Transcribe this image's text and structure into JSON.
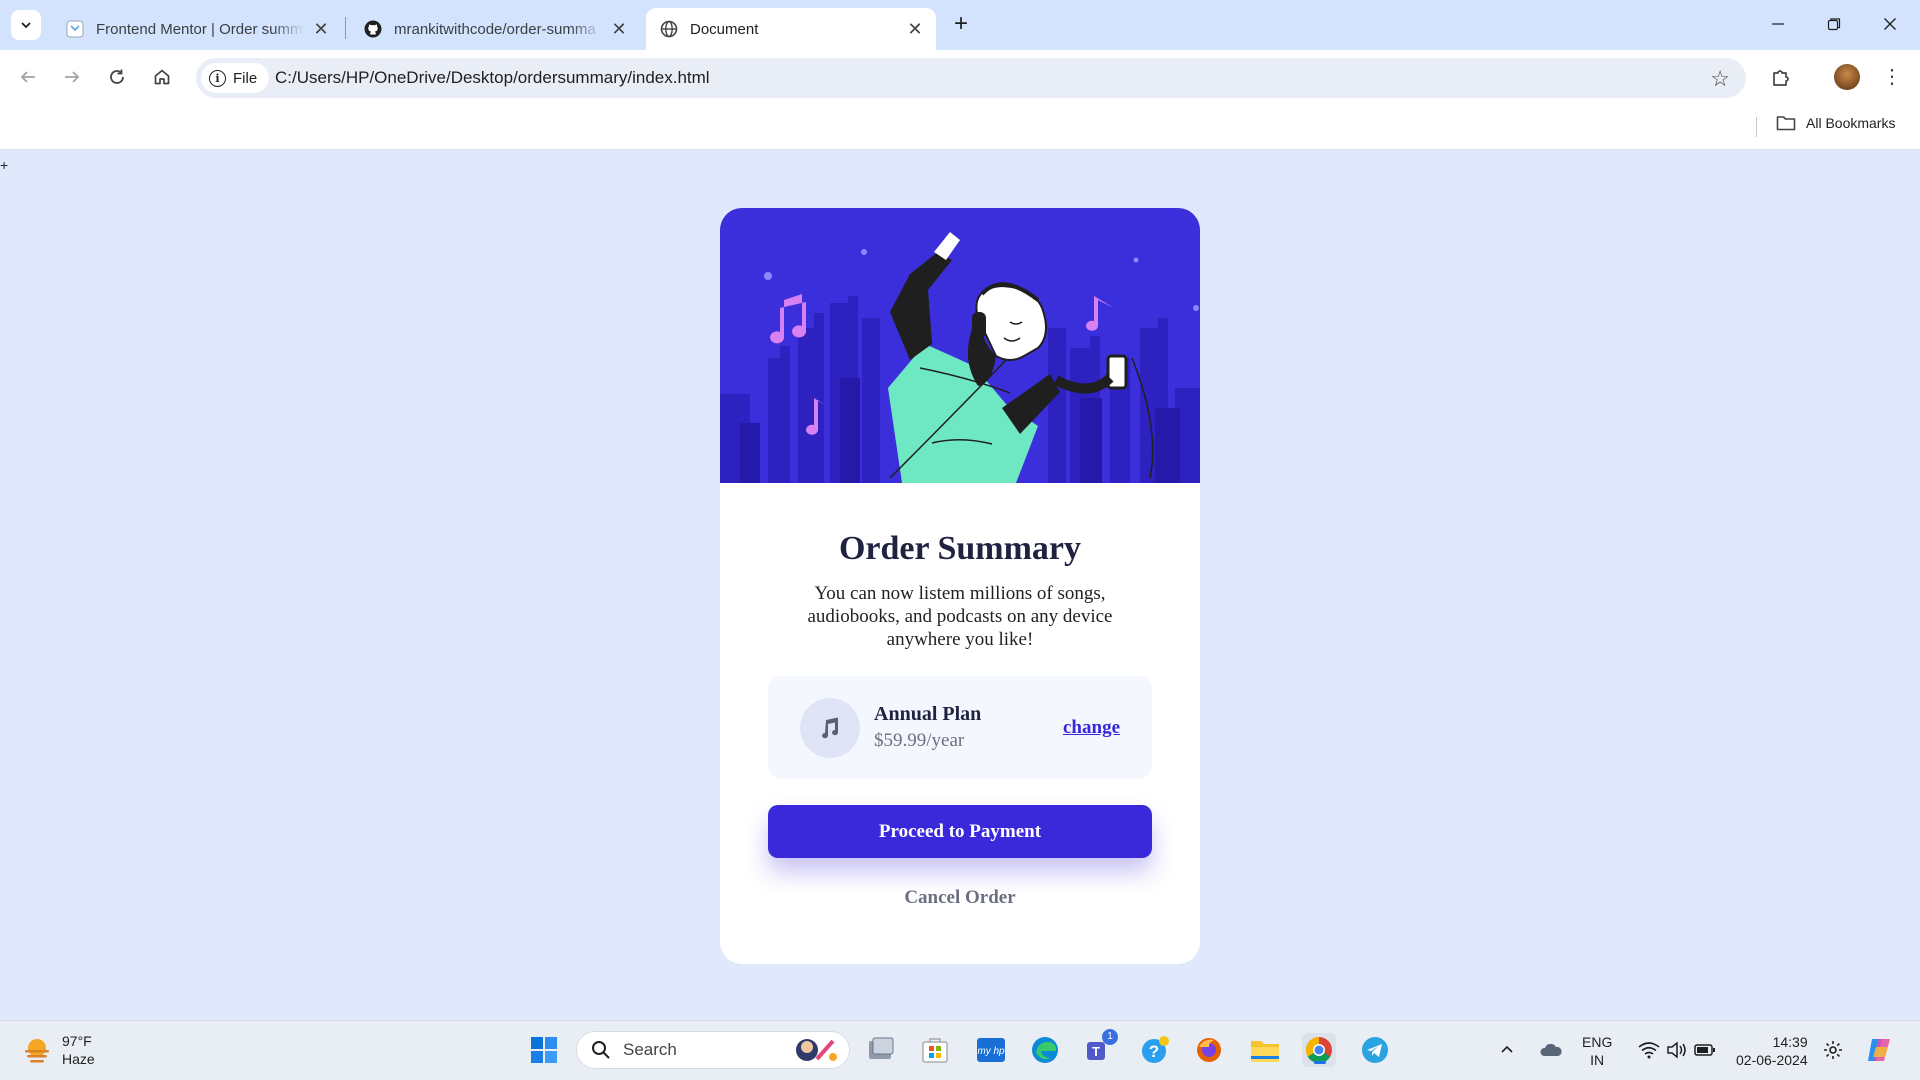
{
  "browser": {
    "tabs": [
      {
        "title": "Frontend Mentor | Order summ",
        "icon": "frontend-mentor-icon",
        "active": false
      },
      {
        "title": "mrankitwithcode/order-summa",
        "icon": "github-icon",
        "active": false
      },
      {
        "title": "Document",
        "icon": "globe-icon",
        "active": true
      }
    ],
    "close_glyph": "✕",
    "new_tab_glyph": "+",
    "chip_label": "File",
    "url": "C:/Users/HP/OneDrive/Desktop/ordersummary/index.html",
    "bookmarks_label": "All Bookmarks"
  },
  "card": {
    "title": "Order Summary",
    "description": "You can now listem millions of songs, audiobooks, and podcasts on any device anywhere you like!",
    "plan_name": "Annual Plan",
    "plan_price": "$59.99/year",
    "change_label": "change",
    "pay_label": "Proceed to Payment",
    "cancel_label": "Cancel Order"
  },
  "colors": {
    "page_bg": "#e0e8fb",
    "hero_bg": "#3b2edb",
    "primary": "#3a29db",
    "accent": "#6ee8c3"
  },
  "taskbar": {
    "temperature": "97°F",
    "condition": "Haze",
    "search_placeholder": "Search",
    "teams_badge": "1",
    "lang_top": "ENG",
    "lang_bottom": "IN",
    "time": "14:39",
    "date": "02-06-2024"
  }
}
